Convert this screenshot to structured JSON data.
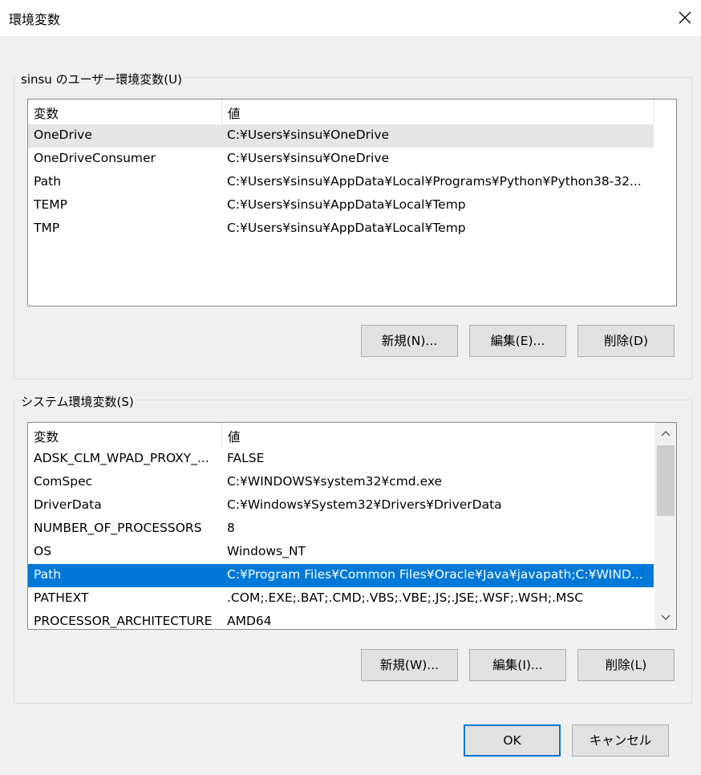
{
  "window": {
    "title": "環境変数"
  },
  "user_section": {
    "legend": "sinsu のユーザー環境変数(U)",
    "columns": {
      "variable": "変数",
      "value": "値"
    },
    "rows": [
      {
        "name": "OneDrive",
        "value": "C:¥Users¥sinsu¥OneDrive"
      },
      {
        "name": "OneDriveConsumer",
        "value": "C:¥Users¥sinsu¥OneDrive"
      },
      {
        "name": "Path",
        "value": "C:¥Users¥sinsu¥AppData¥Local¥Programs¥Python¥Python38-32..."
      },
      {
        "name": "TEMP",
        "value": "C:¥Users¥sinsu¥AppData¥Local¥Temp"
      },
      {
        "name": "TMP",
        "value": "C:¥Users¥sinsu¥AppData¥Local¥Temp"
      }
    ],
    "buttons": {
      "new": "新規(N)...",
      "edit": "編集(E)...",
      "delete": "削除(D)"
    }
  },
  "system_section": {
    "legend": "システム環境変数(S)",
    "columns": {
      "variable": "変数",
      "value": "値"
    },
    "rows": [
      {
        "name": "ADSK_CLM_WPAD_PROXY_...",
        "value": "FALSE"
      },
      {
        "name": "ComSpec",
        "value": "C:¥WINDOWS¥system32¥cmd.exe"
      },
      {
        "name": "DriverData",
        "value": "C:¥Windows¥System32¥Drivers¥DriverData"
      },
      {
        "name": "NUMBER_OF_PROCESSORS",
        "value": "8"
      },
      {
        "name": "OS",
        "value": "Windows_NT"
      },
      {
        "name": "Path",
        "value": "C:¥Program Files¥Common Files¥Oracle¥Java¥javapath;C:¥WIND..."
      },
      {
        "name": "PATHEXT",
        "value": ".COM;.EXE;.BAT;.CMD;.VBS;.VBE;.JS;.JSE;.WSF;.WSH;.MSC"
      },
      {
        "name": "PROCESSOR_ARCHITECTURE",
        "value": "AMD64"
      }
    ],
    "selected_row": "Path",
    "buttons": {
      "new": "新規(W)...",
      "edit": "編集(I)...",
      "delete": "削除(L)"
    }
  },
  "footer": {
    "ok": "OK",
    "cancel": "キャンセル"
  },
  "icons": {
    "close": "close-icon",
    "scroll_up": "chevron-up-icon",
    "scroll_down": "chevron-down-icon"
  },
  "colors": {
    "selection": "#0078d7",
    "hover": "#e5e5e5",
    "dialog_bg": "#f0f0f0"
  }
}
